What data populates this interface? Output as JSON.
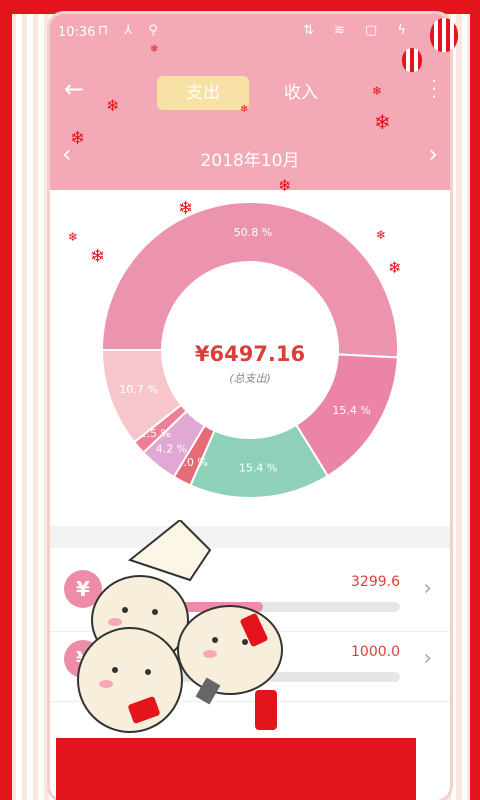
{
  "status_bar": {
    "time": "10:36",
    "left_icons": "⊓ ⅄ ⚲",
    "right_icons": "⇅ ≋ ▢ ϟ"
  },
  "header": {
    "tabs": [
      {
        "label": "支出",
        "active": true
      },
      {
        "label": "收入",
        "active": false
      }
    ],
    "month": "2018年10月"
  },
  "summary": {
    "total_amount": "¥6497.16",
    "total_label": "(总支出)"
  },
  "chart_data": {
    "type": "pie",
    "values": [
      50.8,
      15.4,
      15.4,
      2.0,
      4.2,
      1.5,
      10.7
    ],
    "labels": [
      "50.8 %",
      "15.4 %",
      "15.4 %",
      "2.0 %",
      "4.2 %",
      "1.5 %",
      "10.7 %"
    ],
    "colors": [
      "#ec94ae",
      "#ec84a8",
      "#8fd1b8",
      "#e66b76",
      "#e0a8d2",
      "#ef7f98",
      "#f6c6cc"
    ],
    "title": "",
    "legend": "none",
    "style": "donut"
  },
  "categories": [
    {
      "icon": "¥",
      "amount": "3299.6",
      "fraction": 0.51
    },
    {
      "icon": "¥",
      "amount": "1000.0",
      "fraction": 0.154
    }
  ],
  "colors": {
    "header_pink": "#f4a9b6",
    "accent_red": "#e3141c",
    "amount_red": "#d9403a",
    "tab_active": "#f8e1a5"
  }
}
